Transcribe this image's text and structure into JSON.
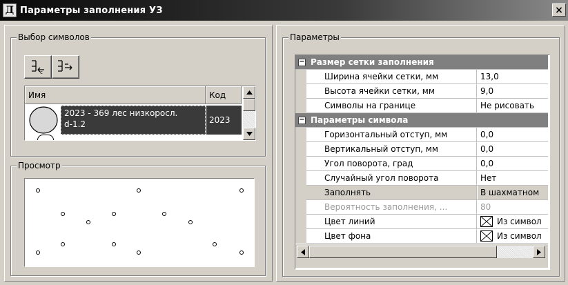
{
  "window": {
    "title": "Параметры заполнения УЗ",
    "close_label": "×"
  },
  "symbols_group": {
    "legend": "Выбор символов",
    "toolbar": [
      {
        "name": "add-symbol-button",
        "icon": "add-symbol-icon"
      },
      {
        "name": "remove-symbol-button",
        "icon": "remove-symbol-icon"
      }
    ],
    "columns": {
      "name": "Имя",
      "code": "Код"
    },
    "rows": [
      {
        "name_line1": "2023 - 369 лес низкоросл.",
        "name_line2": "d-1.2",
        "code": "2023",
        "selected": true
      }
    ]
  },
  "preview_group": {
    "legend": "Просмотр"
  },
  "params_group": {
    "legend": "Параметры",
    "sections": [
      {
        "title": "Размер сетки заполнения",
        "rows": [
          {
            "name": "Ширина ячейки сетки, мм",
            "value": "13,0"
          },
          {
            "name": "Высота ячейки сетки, мм",
            "value": "9,0"
          },
          {
            "name": "Символы на границе",
            "value": "Не рисовать"
          }
        ]
      },
      {
        "title": "Параметры символа",
        "rows": [
          {
            "name": "Горизонтальный отступ, мм",
            "value": "0,0"
          },
          {
            "name": "Вертикальный отступ, мм",
            "value": "0,0"
          },
          {
            "name": "Угол поворота, град",
            "value": "0,0"
          },
          {
            "name": "Случайный угол поворота",
            "value": "Нет"
          },
          {
            "name": "Заполнять",
            "value": "В шахматном"
          },
          {
            "name": "Вероятность заполнения, ...",
            "value": "80",
            "disabled": true
          },
          {
            "name": "Цвет линий",
            "value": "Из символ",
            "color_swatch": true
          },
          {
            "name": "Цвет фона",
            "value": "Из символ",
            "color_swatch": true
          }
        ]
      }
    ]
  },
  "colors": {
    "selection": "#3a3a3a",
    "category": "#808080",
    "face": "#d4d0c8",
    "disabled_text": "#9a9a9a"
  }
}
